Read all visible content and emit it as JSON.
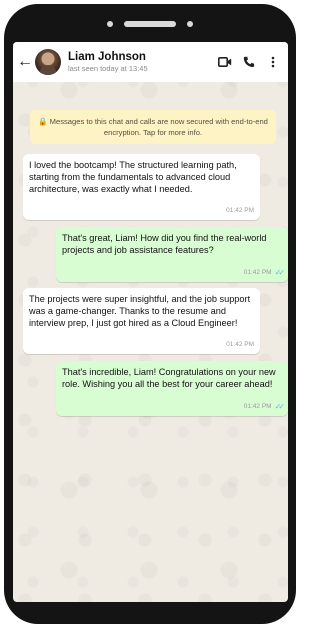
{
  "contact": {
    "name": "Liam Johnson",
    "last_seen": "last seen today at 13:45"
  },
  "header_icons": [
    "back-arrow-icon",
    "video-call-icon",
    "phone-icon",
    "more-options-icon"
  ],
  "encryption_notice": "🔒 Messages to this chat and calls are now secured with end-to-end encryption. Tap for more info.",
  "messages": [
    {
      "direction": "in",
      "text": "I loved the bootcamp! The structured learning path, starting from the fundamentals to advanced cloud architecture, was exactly what I needed.",
      "time": "01:42 PM"
    },
    {
      "direction": "out",
      "text": "That's great, Liam! How did you find the real-world projects and job assistance features?",
      "time": "01:42 PM",
      "read": true
    },
    {
      "direction": "in",
      "text": "The projects were super insightful, and the job support was a game-changer. Thanks to the resume and interview prep, I just got hired as a Cloud Engineer!",
      "time": "01:42 PM"
    },
    {
      "direction": "out",
      "text": "That's incredible, Liam! Congratulations on your new role. Wishing you all the best for your career ahead!",
      "time": "01:42 PM",
      "read": true
    }
  ],
  "colors": {
    "chat_background": "#efeae2",
    "outgoing_bubble": "#d9fdd3",
    "incoming_bubble": "#ffffff",
    "encryption_banner": "#fdf3c4",
    "read_ticks": "#53bdeb",
    "phone_frame": "#141414"
  }
}
